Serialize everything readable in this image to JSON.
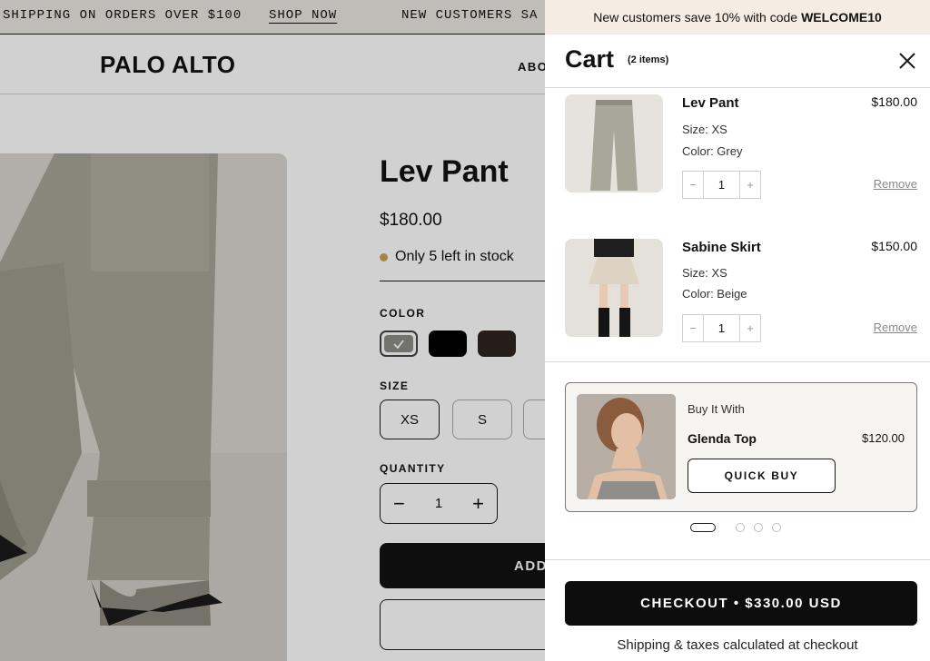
{
  "announcement": {
    "text_left": "SHIPPING ON ORDERS OVER $100",
    "shop_now": "SHOP NOW",
    "text_right": "NEW CUSTOMERS SA"
  },
  "site": {
    "logo": "PALO ALTO",
    "nav_partial": "ABO"
  },
  "product": {
    "title": "Lev Pant",
    "price": "$180.00",
    "stock": "Only 5 left in stock",
    "color_label": "COLOR",
    "colors": [
      "#8b8b87",
      "#000000",
      "#2e2420"
    ],
    "size_label": "SIZE",
    "sizes": [
      "XS",
      "S"
    ],
    "quantity_label": "QUANTITY",
    "quantity": "1",
    "add_partial": "ADD"
  },
  "cart": {
    "promo_text": "New customers save 10% with code",
    "promo_code": "WELCOME10",
    "title": "Cart",
    "count": "(2 items)",
    "items": [
      {
        "name": "Lev Pant",
        "price": "$180.00",
        "size": "Size: XS",
        "color": "Color: Grey",
        "qty": "1",
        "remove": "Remove"
      },
      {
        "name": "Sabine Skirt",
        "price": "$150.00",
        "size": "Size: XS",
        "color": "Color: Beige",
        "qty": "1",
        "remove": "Remove"
      }
    ],
    "upsell": {
      "kicker": "Buy It With",
      "name": "Glenda Top",
      "price": "$120.00",
      "button": "QUICK BUY"
    },
    "checkout": "CHECKOUT • $330.00 USD",
    "footnote": "Shipping & taxes calculated at checkout"
  }
}
